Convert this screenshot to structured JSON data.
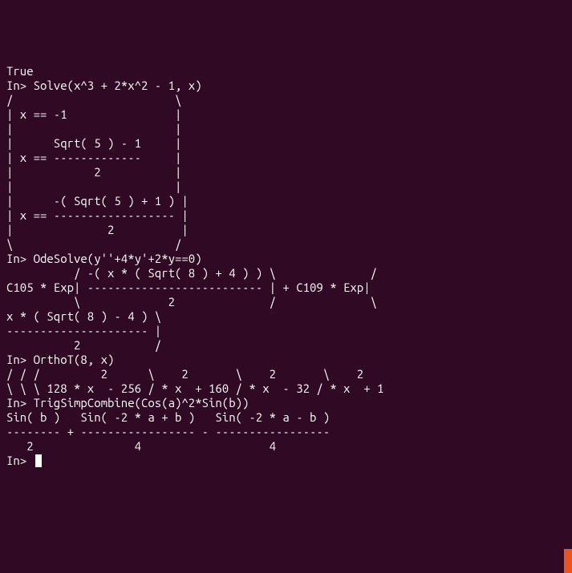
{
  "terminal": {
    "lines": [
      "True",
      "",
      "In> Solve(x^3 + 2*x^2 - 1, x)",
      "",
      "/                        \\",
      "| x == -1                |",
      "|                        |",
      "|      Sqrt( 5 ) - 1     |",
      "| x == -------------     |",
      "|            2           |",
      "|                        |",
      "|      -( Sqrt( 5 ) + 1 ) |",
      "| x == ------------------ |",
      "|              2          |",
      "\\                        /",
      "",
      "In> OdeSolve(y''+4*y'+2*y==0)",
      "",
      "          / -( x * ( Sqrt( 8 ) + 4 ) ) \\              /",
      "C105 * Exp| -------------------------- | + C109 * Exp|",
      "          \\             2              /              \\",
      "",
      "x * ( Sqrt( 8 ) - 4 ) \\",
      "--------------------- |",
      "          2           /",
      "",
      "In> OrthoT(8, x)",
      "",
      "/ / /         2      \\    2       \\    2       \\    2",
      "\\ \\ \\ 128 * x  - 256 / * x  + 160 / * x  - 32 / * x  + 1",
      "",
      "In> TrigSimpCombine(Cos(a)^2*Sin(b))",
      "",
      "Sin( b )   Sin( -2 * a + b )   Sin( -2 * a - b )",
      "-------- + ----------------- - -----------------",
      "   2               4                   4",
      "",
      "In> "
    ]
  }
}
